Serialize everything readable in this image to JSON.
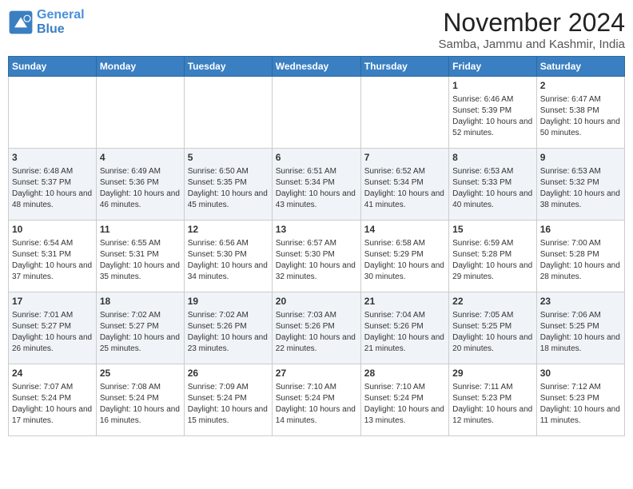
{
  "header": {
    "logo_line1": "General",
    "logo_line2": "Blue",
    "month": "November 2024",
    "location": "Samba, Jammu and Kashmir, India"
  },
  "weekdays": [
    "Sunday",
    "Monday",
    "Tuesday",
    "Wednesday",
    "Thursday",
    "Friday",
    "Saturday"
  ],
  "weeks": [
    [
      {
        "day": "",
        "info": ""
      },
      {
        "day": "",
        "info": ""
      },
      {
        "day": "",
        "info": ""
      },
      {
        "day": "",
        "info": ""
      },
      {
        "day": "",
        "info": ""
      },
      {
        "day": "1",
        "info": "Sunrise: 6:46 AM\nSunset: 5:39 PM\nDaylight: 10 hours and 52 minutes."
      },
      {
        "day": "2",
        "info": "Sunrise: 6:47 AM\nSunset: 5:38 PM\nDaylight: 10 hours and 50 minutes."
      }
    ],
    [
      {
        "day": "3",
        "info": "Sunrise: 6:48 AM\nSunset: 5:37 PM\nDaylight: 10 hours and 48 minutes."
      },
      {
        "day": "4",
        "info": "Sunrise: 6:49 AM\nSunset: 5:36 PM\nDaylight: 10 hours and 46 minutes."
      },
      {
        "day": "5",
        "info": "Sunrise: 6:50 AM\nSunset: 5:35 PM\nDaylight: 10 hours and 45 minutes."
      },
      {
        "day": "6",
        "info": "Sunrise: 6:51 AM\nSunset: 5:34 PM\nDaylight: 10 hours and 43 minutes."
      },
      {
        "day": "7",
        "info": "Sunrise: 6:52 AM\nSunset: 5:34 PM\nDaylight: 10 hours and 41 minutes."
      },
      {
        "day": "8",
        "info": "Sunrise: 6:53 AM\nSunset: 5:33 PM\nDaylight: 10 hours and 40 minutes."
      },
      {
        "day": "9",
        "info": "Sunrise: 6:53 AM\nSunset: 5:32 PM\nDaylight: 10 hours and 38 minutes."
      }
    ],
    [
      {
        "day": "10",
        "info": "Sunrise: 6:54 AM\nSunset: 5:31 PM\nDaylight: 10 hours and 37 minutes."
      },
      {
        "day": "11",
        "info": "Sunrise: 6:55 AM\nSunset: 5:31 PM\nDaylight: 10 hours and 35 minutes."
      },
      {
        "day": "12",
        "info": "Sunrise: 6:56 AM\nSunset: 5:30 PM\nDaylight: 10 hours and 34 minutes."
      },
      {
        "day": "13",
        "info": "Sunrise: 6:57 AM\nSunset: 5:30 PM\nDaylight: 10 hours and 32 minutes."
      },
      {
        "day": "14",
        "info": "Sunrise: 6:58 AM\nSunset: 5:29 PM\nDaylight: 10 hours and 30 minutes."
      },
      {
        "day": "15",
        "info": "Sunrise: 6:59 AM\nSunset: 5:28 PM\nDaylight: 10 hours and 29 minutes."
      },
      {
        "day": "16",
        "info": "Sunrise: 7:00 AM\nSunset: 5:28 PM\nDaylight: 10 hours and 28 minutes."
      }
    ],
    [
      {
        "day": "17",
        "info": "Sunrise: 7:01 AM\nSunset: 5:27 PM\nDaylight: 10 hours and 26 minutes."
      },
      {
        "day": "18",
        "info": "Sunrise: 7:02 AM\nSunset: 5:27 PM\nDaylight: 10 hours and 25 minutes."
      },
      {
        "day": "19",
        "info": "Sunrise: 7:02 AM\nSunset: 5:26 PM\nDaylight: 10 hours and 23 minutes."
      },
      {
        "day": "20",
        "info": "Sunrise: 7:03 AM\nSunset: 5:26 PM\nDaylight: 10 hours and 22 minutes."
      },
      {
        "day": "21",
        "info": "Sunrise: 7:04 AM\nSunset: 5:26 PM\nDaylight: 10 hours and 21 minutes."
      },
      {
        "day": "22",
        "info": "Sunrise: 7:05 AM\nSunset: 5:25 PM\nDaylight: 10 hours and 20 minutes."
      },
      {
        "day": "23",
        "info": "Sunrise: 7:06 AM\nSunset: 5:25 PM\nDaylight: 10 hours and 18 minutes."
      }
    ],
    [
      {
        "day": "24",
        "info": "Sunrise: 7:07 AM\nSunset: 5:24 PM\nDaylight: 10 hours and 17 minutes."
      },
      {
        "day": "25",
        "info": "Sunrise: 7:08 AM\nSunset: 5:24 PM\nDaylight: 10 hours and 16 minutes."
      },
      {
        "day": "26",
        "info": "Sunrise: 7:09 AM\nSunset: 5:24 PM\nDaylight: 10 hours and 15 minutes."
      },
      {
        "day": "27",
        "info": "Sunrise: 7:10 AM\nSunset: 5:24 PM\nDaylight: 10 hours and 14 minutes."
      },
      {
        "day": "28",
        "info": "Sunrise: 7:10 AM\nSunset: 5:24 PM\nDaylight: 10 hours and 13 minutes."
      },
      {
        "day": "29",
        "info": "Sunrise: 7:11 AM\nSunset: 5:23 PM\nDaylight: 10 hours and 12 minutes."
      },
      {
        "day": "30",
        "info": "Sunrise: 7:12 AM\nSunset: 5:23 PM\nDaylight: 10 hours and 11 minutes."
      }
    ]
  ]
}
